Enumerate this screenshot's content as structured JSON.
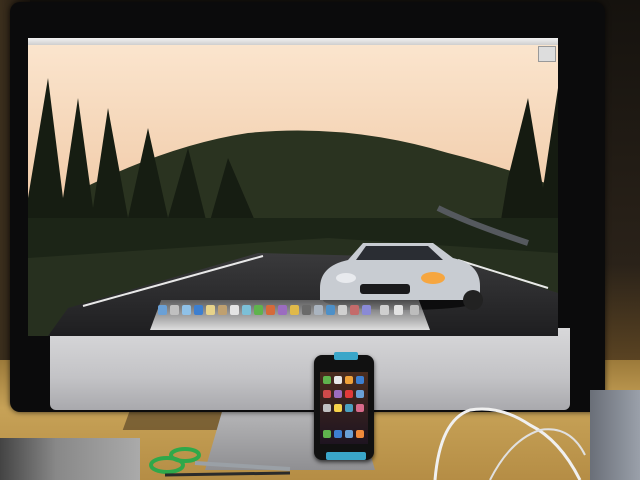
{
  "scene": {
    "subject": "desk-with-computer",
    "colors": {
      "sky_top": "#f5d7b8",
      "sky_bottom": "#c98f6a",
      "forest": "#1f2a18",
      "road": "#2b2b2d",
      "car": "#c8ccd2",
      "monitor_chin": "#c9c9cc",
      "desk": "#b58d45",
      "phone_clip": "#3aa6c9",
      "scissors": "#2fa84a"
    }
  },
  "icons": {
    "apple_logo": "apple-logo-icon",
    "apple_glyph": ""
  }
}
